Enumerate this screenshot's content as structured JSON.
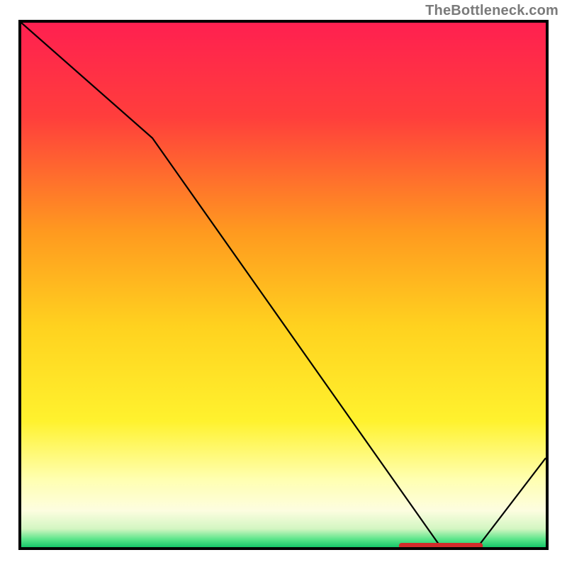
{
  "attribution": "TheBottleneck.com",
  "marker_label": "",
  "chart_data": {
    "type": "line",
    "title": "",
    "xlabel": "",
    "ylabel": "",
    "xlim": [
      0,
      100
    ],
    "ylim": [
      0,
      100
    ],
    "grid": false,
    "x": [
      0,
      25,
      80,
      87,
      100
    ],
    "values": [
      100,
      78,
      0,
      0,
      17
    ],
    "gradient_stops": [
      {
        "offset": 0.0,
        "color": "#ff2050"
      },
      {
        "offset": 0.18,
        "color": "#ff3e3c"
      },
      {
        "offset": 0.4,
        "color": "#ff9a1f"
      },
      {
        "offset": 0.58,
        "color": "#ffd21f"
      },
      {
        "offset": 0.76,
        "color": "#fff22e"
      },
      {
        "offset": 0.87,
        "color": "#ffffb0"
      },
      {
        "offset": 0.93,
        "color": "#fdfde0"
      },
      {
        "offset": 0.965,
        "color": "#d3f6c2"
      },
      {
        "offset": 0.985,
        "color": "#5be58a"
      },
      {
        "offset": 1.0,
        "color": "#16c76a"
      }
    ],
    "marker": {
      "x_start": 72,
      "x_end": 88,
      "color": "#d22b2b"
    }
  }
}
